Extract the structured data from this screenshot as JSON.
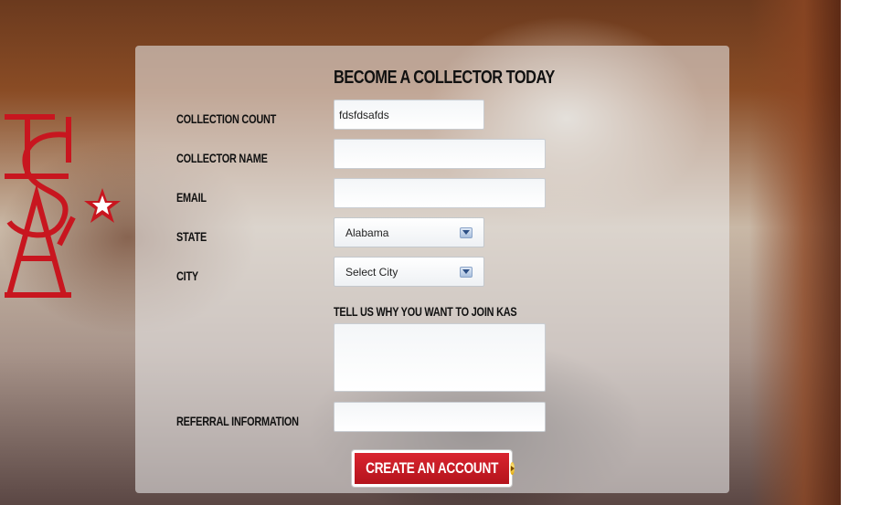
{
  "form": {
    "title": "BECOME A COLLECTOR TODAY",
    "fields": {
      "collection_count": {
        "label": "COLLECTION COUNT",
        "value": "fdsfdsafds"
      },
      "collector_name": {
        "label": "COLLECTOR NAME",
        "value": ""
      },
      "email": {
        "label": "EMAIL",
        "value": ""
      },
      "state": {
        "label": "STATE",
        "value": "Alabama"
      },
      "city": {
        "label": "CITY",
        "value": "Select City"
      },
      "why_join": {
        "label": "TELL US WHY YOU WANT TO JOIN KAS",
        "value": ""
      },
      "referral": {
        "label": "REFERRAL INFORMATION",
        "value": ""
      }
    },
    "submit_label": "CREATE AN ACCOUNT"
  },
  "logo": {
    "text": "KAS"
  },
  "colors": {
    "accent": "#c8161f",
    "panel": "#e8e8e8"
  }
}
